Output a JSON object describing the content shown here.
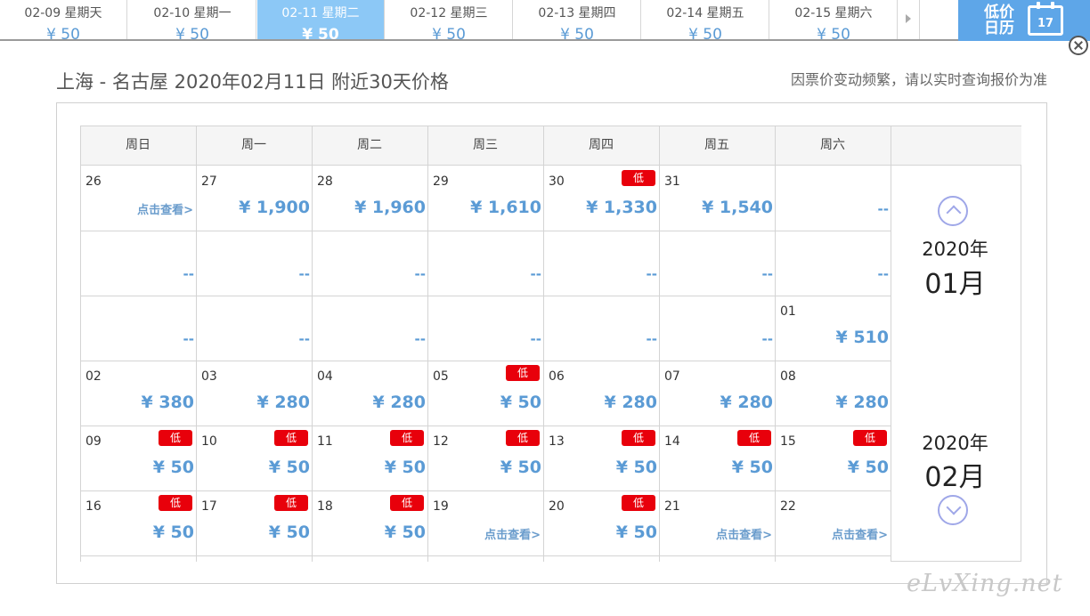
{
  "date_strip": {
    "tabs": [
      {
        "date": "02-09 星期天",
        "price": "¥ 50"
      },
      {
        "date": "02-10 星期一",
        "price": "¥ 50"
      },
      {
        "date": "02-11 星期二",
        "price": "¥ 50",
        "active": true
      },
      {
        "date": "02-12 星期三",
        "price": "¥ 50"
      },
      {
        "date": "02-13 星期四",
        "price": "¥ 50"
      },
      {
        "date": "02-14 星期五",
        "price": "¥ 50"
      },
      {
        "date": "02-15 星期六",
        "price": "¥ 50"
      }
    ],
    "calendar_button_label": "低价日历",
    "calendar_icon_day": "17"
  },
  "header": {
    "title": "上海 - 名古屋 2020年02月11日  附近30天价格",
    "notice": "因票价变动频繁，请以实时查询报价为准"
  },
  "calendar": {
    "weekdays": [
      "周日",
      "周一",
      "周二",
      "周三",
      "周四",
      "周五",
      "周六"
    ],
    "low_label": "低",
    "view_label": "点击查看>",
    "rows": [
      [
        {
          "day": "26",
          "price": "点击查看>",
          "link": true
        },
        {
          "day": "27",
          "price": "¥ 1,900"
        },
        {
          "day": "28",
          "price": "¥ 1,960"
        },
        {
          "day": "29",
          "price": "¥ 1,610"
        },
        {
          "day": "30",
          "price": "¥ 1,330",
          "low": true
        },
        {
          "day": "31",
          "price": "¥ 1,540"
        },
        {
          "day": "",
          "price": "--"
        }
      ],
      [
        {
          "day": "",
          "price": "--"
        },
        {
          "day": "",
          "price": "--"
        },
        {
          "day": "",
          "price": "--"
        },
        {
          "day": "",
          "price": "--"
        },
        {
          "day": "",
          "price": "--"
        },
        {
          "day": "",
          "price": "--"
        },
        {
          "day": "",
          "price": "--"
        }
      ],
      [
        {
          "day": "",
          "price": "--"
        },
        {
          "day": "",
          "price": "--"
        },
        {
          "day": "",
          "price": "--"
        },
        {
          "day": "",
          "price": "--"
        },
        {
          "day": "",
          "price": "--"
        },
        {
          "day": "",
          "price": "--"
        },
        {
          "day": "01",
          "price": "¥ 510"
        }
      ],
      [
        {
          "day": "02",
          "price": "¥ 380"
        },
        {
          "day": "03",
          "price": "¥ 280"
        },
        {
          "day": "04",
          "price": "¥ 280"
        },
        {
          "day": "05",
          "price": "¥ 50",
          "low": true
        },
        {
          "day": "06",
          "price": "¥ 280"
        },
        {
          "day": "07",
          "price": "¥ 280"
        },
        {
          "day": "08",
          "price": "¥ 280"
        }
      ],
      [
        {
          "day": "09",
          "price": "¥ 50",
          "low": true
        },
        {
          "day": "10",
          "price": "¥ 50",
          "low": true
        },
        {
          "day": "11",
          "price": "¥ 50",
          "low": true
        },
        {
          "day": "12",
          "price": "¥ 50",
          "low": true
        },
        {
          "day": "13",
          "price": "¥ 50",
          "low": true
        },
        {
          "day": "14",
          "price": "¥ 50",
          "low": true
        },
        {
          "day": "15",
          "price": "¥ 50",
          "low": true
        }
      ],
      [
        {
          "day": "16",
          "price": "¥ 50",
          "low": true
        },
        {
          "day": "17",
          "price": "¥ 50",
          "low": true
        },
        {
          "day": "18",
          "price": "¥ 50",
          "low": true
        },
        {
          "day": "19",
          "price": "点击查看>",
          "link": true
        },
        {
          "day": "20",
          "price": "¥ 50",
          "low": true
        },
        {
          "day": "21",
          "price": "点击查看>",
          "link": true
        },
        {
          "day": "22",
          "price": "点击查看>",
          "link": true
        }
      ]
    ],
    "months": [
      {
        "year": "2020年",
        "month": "01月"
      },
      {
        "year": "2020年",
        "month": "02月"
      }
    ]
  },
  "watermark": "eLvXing.net",
  "colors": {
    "accent": "#5ea6e8",
    "active_tab": "#8cc8f6",
    "price": "#5b9bd5",
    "low_badge": "#e8000b"
  }
}
